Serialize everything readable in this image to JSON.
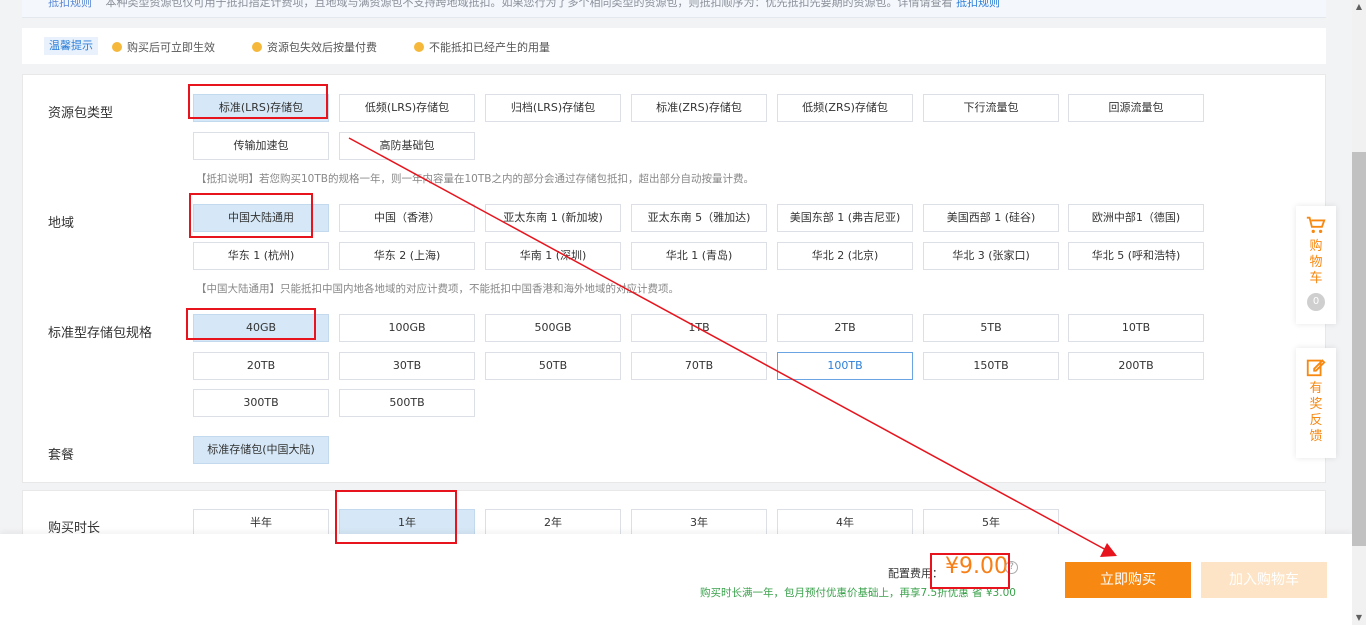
{
  "info_top": {
    "tag": "抵扣规则",
    "text": "本种类型资源包仅可用于抵扣指定计费项，且地域与满资源包不支持跨地域抵扣。如果您行为了多个相同类型的资源包，则抵扣顺序为：优先抵扣先要期的资源包。详情请查看",
    "link": "抵扣规则"
  },
  "tips": {
    "label": "温馨提示",
    "items": [
      "购买后可立即生效",
      "资源包失效后按量付费",
      "不能抵扣已经产生的用量"
    ]
  },
  "sections": {
    "pkg_type": {
      "label": "资源包类型",
      "options": [
        "标准(LRS)存储包",
        "低频(LRS)存储包",
        "归档(LRS)存储包",
        "标准(ZRS)存储包",
        "低频(ZRS)存储包",
        "下行流量包",
        "回源流量包",
        "传输加速包",
        "高防基础包"
      ],
      "note": "【抵扣说明】若您购买10TB的规格一年，则一年内容量在10TB之内的部分会通过存储包抵扣，超出部分自动按量计费。"
    },
    "region": {
      "label": "地域",
      "options": [
        "中国大陆通用",
        "中国（香港）",
        "亚太东南 1 (新加坡)",
        "亚太东南 5（雅加达)",
        "美国东部 1 (弗吉尼亚)",
        "美国西部 1 (硅谷)",
        "欧洲中部1（德国)",
        "华东 1 (杭州)",
        "华东 2 (上海)",
        "华南 1 (深圳)",
        "华北 1 (青岛)",
        "华北 2 (北京)",
        "华北 3 (张家口)",
        "华北 5 (呼和浩特)"
      ],
      "note": "【中国大陆通用】只能抵扣中国内地各地域的对应计费项，不能抵扣中国香港和海外地域的对应计费项。"
    },
    "spec": {
      "label": "标准型存储包规格",
      "options": [
        "40GB",
        "100GB",
        "500GB",
        "1TB",
        "2TB",
        "5TB",
        "10TB",
        "20TB",
        "30TB",
        "50TB",
        "70TB",
        "100TB",
        "150TB",
        "200TB",
        "300TB",
        "500TB"
      ]
    },
    "plan": {
      "label": "套餐",
      "options": [
        "标准存储包(中国大陆)"
      ]
    },
    "duration": {
      "label": "购买时长",
      "options": [
        "半年",
        "1年",
        "2年",
        "3年",
        "4年",
        "5年"
      ]
    }
  },
  "footer": {
    "fee_label": "配置费用：",
    "price": "¥9.00",
    "help": "?",
    "promo": "购买时长满一年，包月预付优惠价基础上，再享7.5折优惠 省 ¥3.00",
    "buy": "立即购买",
    "add_cart": "加入购物车"
  },
  "float": {
    "cart_label": "购物车",
    "cart_count": "0",
    "feedback_label": "有奖反馈"
  },
  "colors": {
    "accent": "#f78812",
    "selected_bg": "#d6e8f7",
    "annotation": "#e8141d",
    "link": "#2d7fd8"
  }
}
